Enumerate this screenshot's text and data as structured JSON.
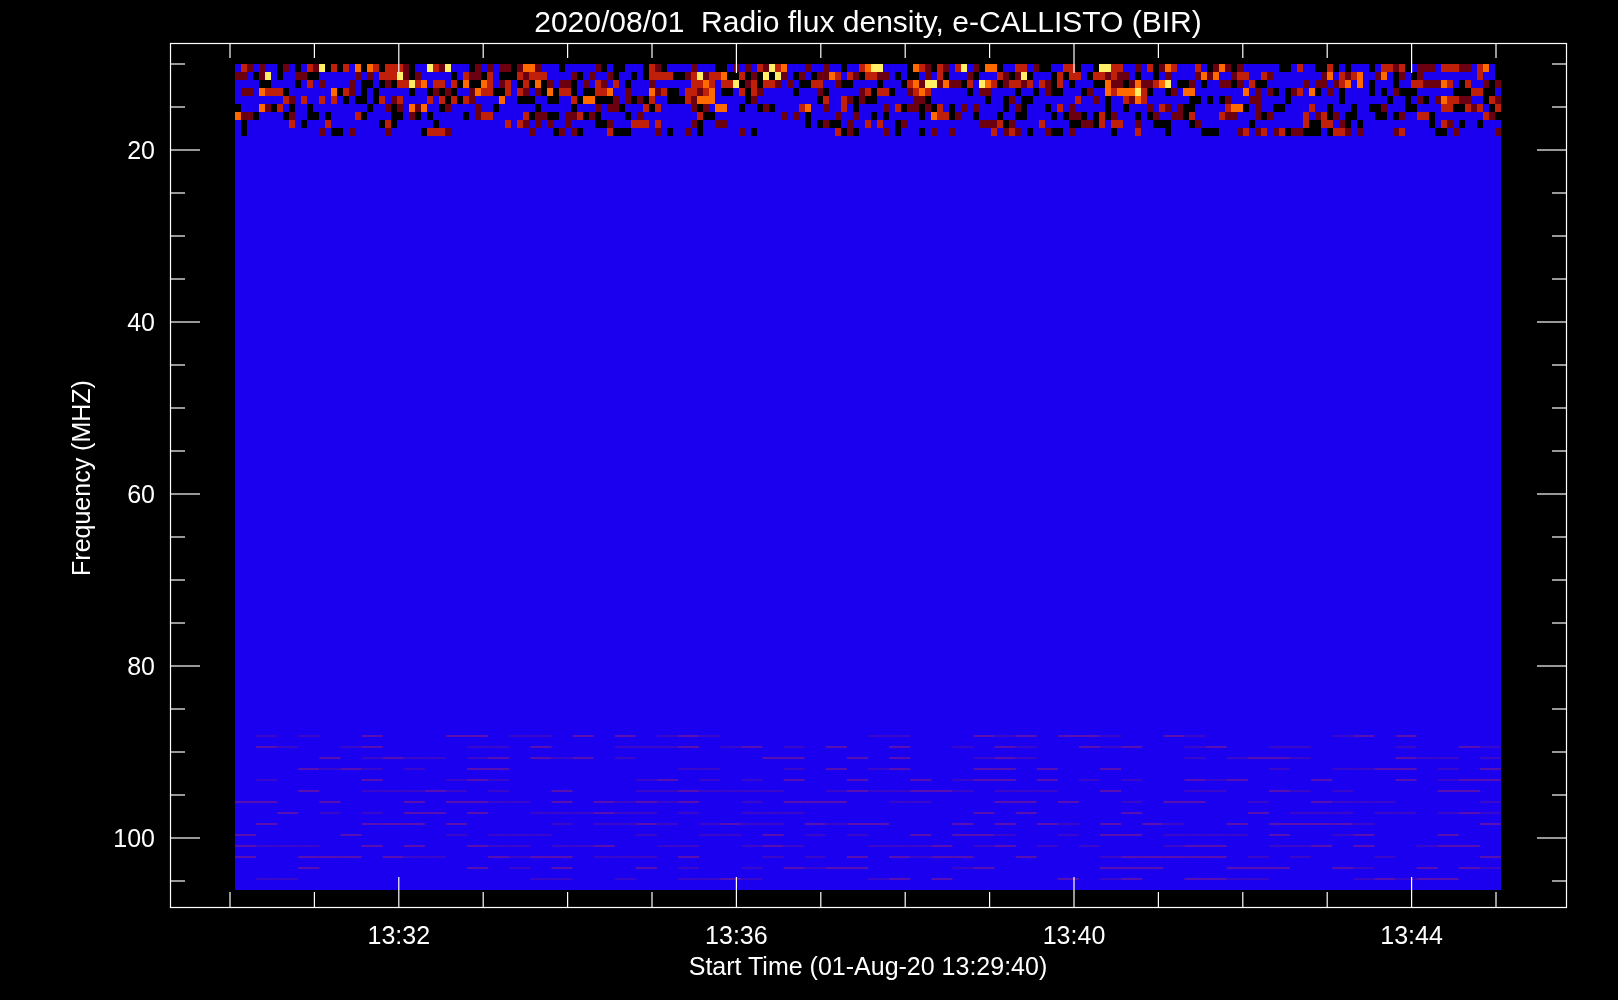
{
  "title": "2020/08/01  Radio flux density, e-CALLISTO (BIR)",
  "y_axis": {
    "label": "Frequency (MHZ)",
    "ticks": [
      "20",
      "40",
      "60",
      "80",
      "100"
    ]
  },
  "x_axis": {
    "label": "Start Time (01-Aug-20 13:29:40)",
    "ticks": [
      "13:32",
      "13:36",
      "13:40",
      "13:44"
    ]
  }
}
